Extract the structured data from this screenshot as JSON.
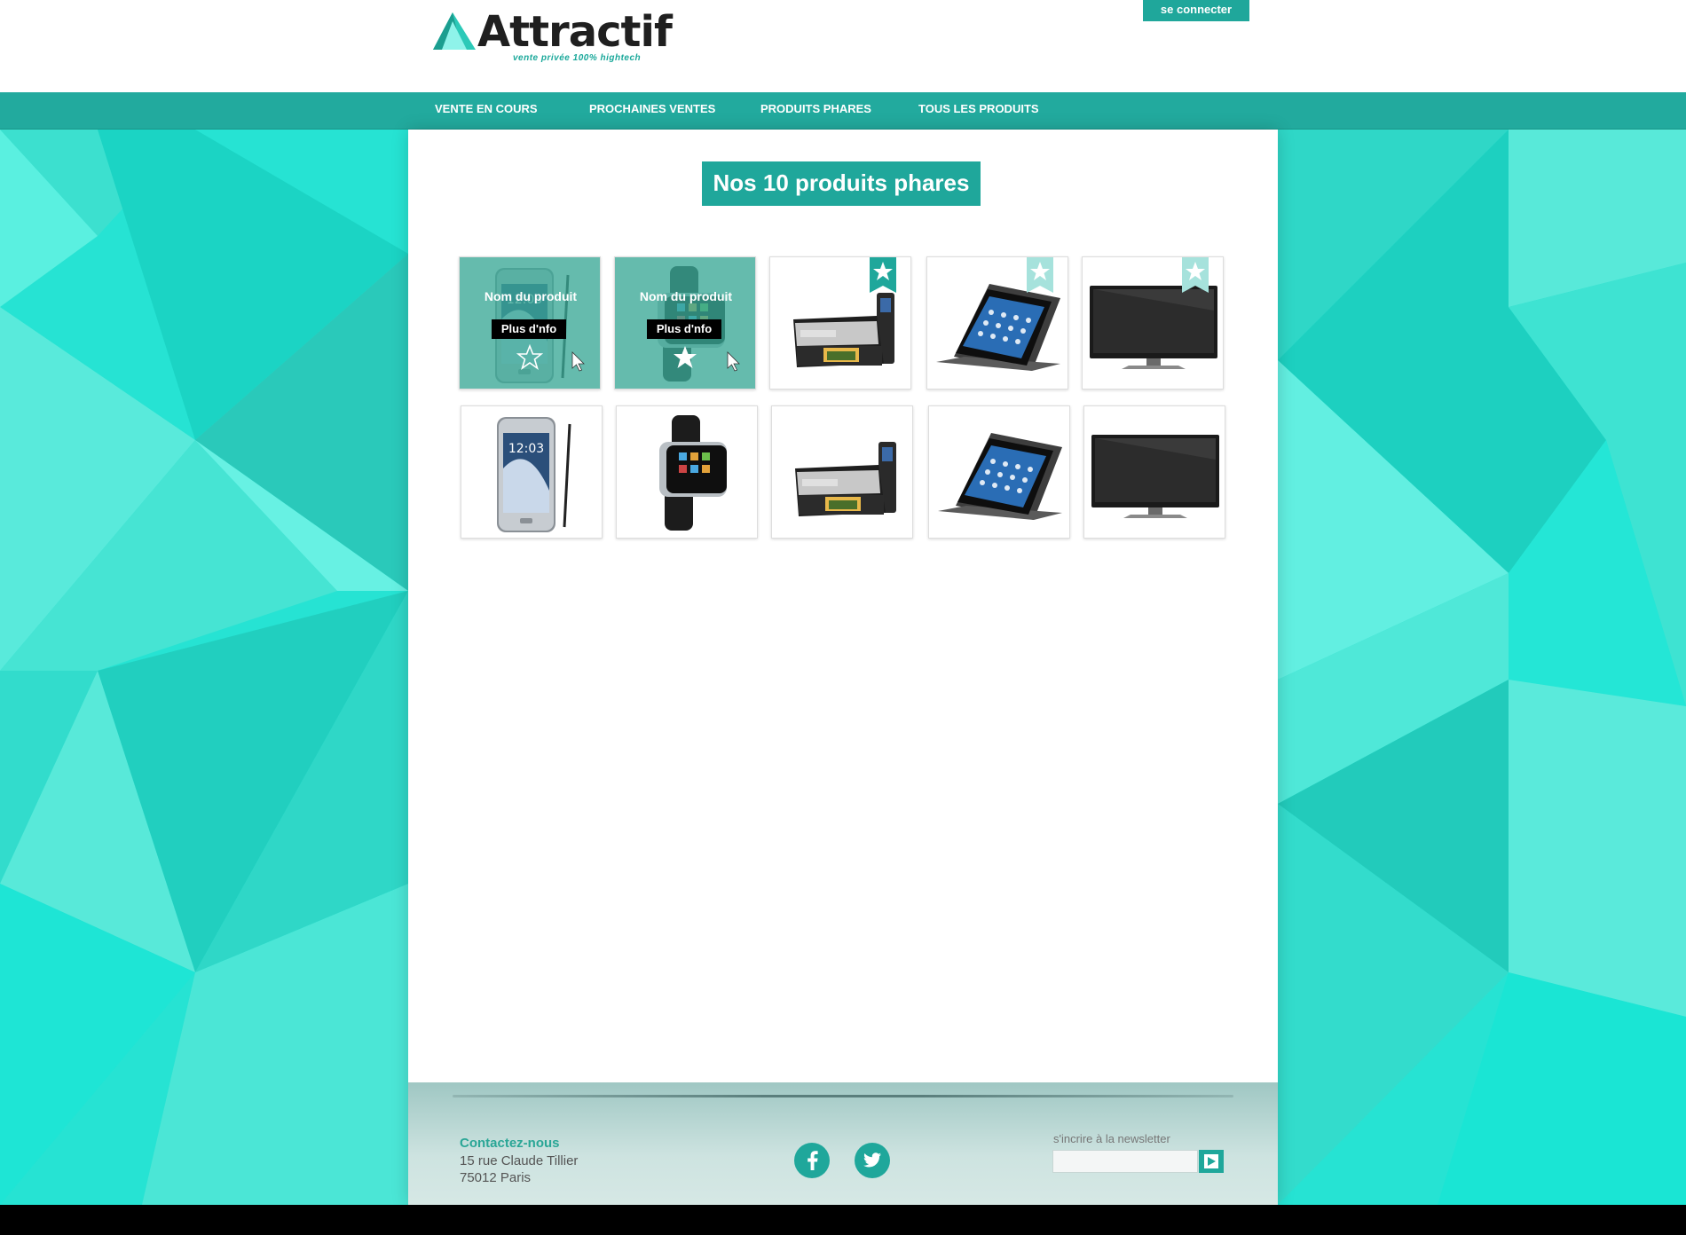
{
  "brand": {
    "name": "Attractif",
    "tagline": "vente privée 100% hightech"
  },
  "header": {
    "login_label": "se connecter"
  },
  "nav": {
    "items": [
      {
        "label": "VENTE EN COURS"
      },
      {
        "label": "PROCHAINES VENTES"
      },
      {
        "label": "PRODUITS PHARES"
      },
      {
        "label": "TOUS LES PRODUITS"
      }
    ]
  },
  "main": {
    "title": "Nos 10 produits phares",
    "overlay": {
      "product_name": "Nom du produit",
      "more_label": "Plus d'nfo"
    },
    "products": [
      {
        "kind": "phone",
        "state": "hover",
        "star": "outline"
      },
      {
        "kind": "watch",
        "state": "hover",
        "star": "filled"
      },
      {
        "kind": "printer",
        "state": "normal",
        "ribbon": "dark"
      },
      {
        "kind": "tablet",
        "state": "normal",
        "ribbon": "light"
      },
      {
        "kind": "tv",
        "state": "normal",
        "ribbon": "light"
      },
      {
        "kind": "phone",
        "state": "normal"
      },
      {
        "kind": "watch",
        "state": "normal"
      },
      {
        "kind": "printer",
        "state": "normal"
      },
      {
        "kind": "tablet",
        "state": "normal"
      },
      {
        "kind": "tv",
        "state": "normal"
      }
    ],
    "phone_time": "12:03"
  },
  "footer": {
    "contact_title": "Contactez-nous",
    "address_line1": "15 rue Claude Tillier",
    "address_line2": "75012 Paris",
    "social": [
      "facebook-icon",
      "twitter-icon"
    ],
    "newsletter_label": "s'incrire à la newsletter",
    "newsletter_value": ""
  },
  "colors": {
    "accent": "#1fa79b",
    "background": "#21e8d8"
  }
}
